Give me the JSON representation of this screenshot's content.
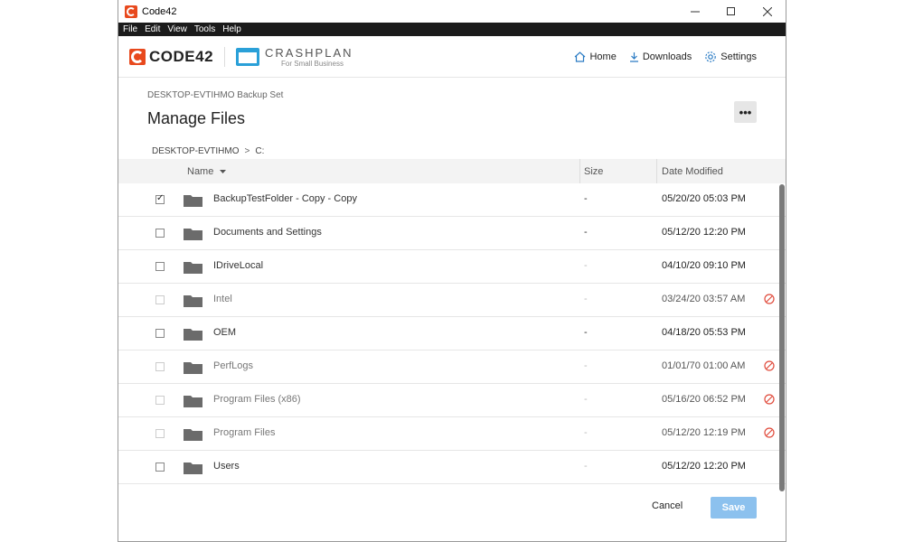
{
  "window": {
    "title": "Code42"
  },
  "menu": [
    "File",
    "Edit",
    "View",
    "Tools",
    "Help"
  ],
  "brand": {
    "code42": "CODE42",
    "crashplan": "CRASHPLAN",
    "crashplan_sub": "For Small Business"
  },
  "nav": {
    "home": "Home",
    "downloads": "Downloads",
    "settings": "Settings"
  },
  "page": {
    "backup_set": "DESKTOP-EVTIHMO Backup Set",
    "title": "Manage Files",
    "more": "•••"
  },
  "breadcrumb": {
    "root": "DESKTOP-EVTIHMO",
    "sep": ">",
    "path": "C:"
  },
  "table": {
    "headers": {
      "name": "Name",
      "size": "Size",
      "date": "Date Modified"
    },
    "rows": [
      {
        "name": "BackupTestFolder - Copy - Copy",
        "size": "-",
        "date": "05/20/20 05:03 PM"
      },
      {
        "name": "Documents and Settings",
        "size": "-",
        "date": "05/12/20 12:20 PM"
      },
      {
        "name": "IDriveLocal",
        "size": "-",
        "date": "04/10/20 09:10 PM"
      },
      {
        "name": "Intel",
        "size": "-",
        "date": "03/24/20 03:57 AM"
      },
      {
        "name": "OEM",
        "size": "-",
        "date": "04/18/20 05:53 PM"
      },
      {
        "name": "PerfLogs",
        "size": "-",
        "date": "01/01/70 01:00 AM"
      },
      {
        "name": "Program Files (x86)",
        "size": "-",
        "date": "05/16/20 06:52 PM"
      },
      {
        "name": "Program Files",
        "size": "-",
        "date": "05/12/20 12:19 PM"
      },
      {
        "name": "Users",
        "size": "-",
        "date": "05/12/20 12:20 PM"
      }
    ]
  },
  "footer": {
    "cancel": "Cancel",
    "save": "Save"
  },
  "colors": {
    "accent": "#e8491d",
    "crashplan_blue": "#2aa0d8",
    "save_disabled": "#8cc1ee",
    "excluded_red": "#e04a3b"
  }
}
